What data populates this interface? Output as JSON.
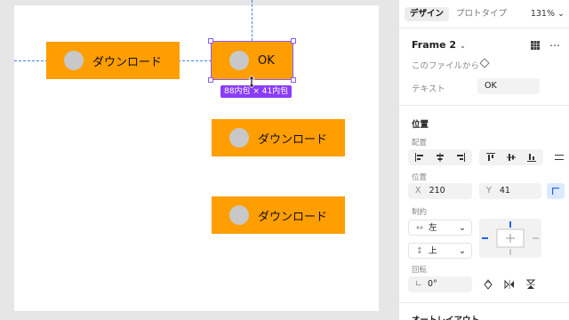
{
  "canvas": {
    "buttons": [
      {
        "label": "ダウンロード"
      },
      {
        "label": "OK"
      },
      {
        "label": "ダウンロード"
      },
      {
        "label": "ダウンロード"
      }
    ],
    "size_badge": "88内包 × 41内包"
  },
  "panel": {
    "tabs": {
      "design": "デザイン",
      "prototype": "プロトタイプ"
    },
    "zoom": "131%",
    "frame_name": "Frame 2",
    "component_source": "このファイルから",
    "text_label": "テキスト",
    "text_value": "OK",
    "position_section": "位置",
    "alignment_label": "配置",
    "position_label": "位置",
    "x_label": "X",
    "x_value": "210",
    "y_label": "Y",
    "y_value": "41",
    "constraints_label": "制約",
    "horizontal_constraint": "左",
    "vertical_constraint": "上",
    "rotation_label": "回転",
    "rotation_value": "0°",
    "auto_layout_section": "オートレイアウト"
  },
  "colors": {
    "accent_orange": "#ff9e00",
    "selection_purple": "#8b5cf6",
    "guide_blue": "#3b82f6"
  }
}
